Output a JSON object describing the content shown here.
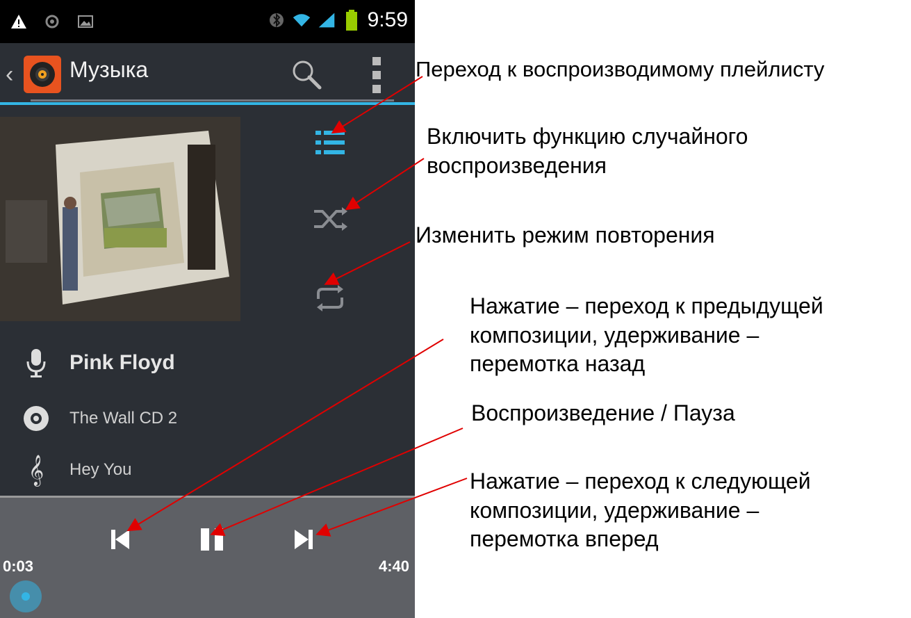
{
  "status_bar": {
    "time": "9:59",
    "left_icons": [
      "warning-icon",
      "record-icon",
      "image-icon"
    ],
    "right_icons": [
      "bluetooth-icon",
      "wifi-icon",
      "signal-icon",
      "battery-icon"
    ]
  },
  "action_bar": {
    "title": "Музыка",
    "icons": [
      "back-icon",
      "music-app-icon",
      "search-icon",
      "overflow-menu-icon"
    ],
    "accent_color": "#33b5e5"
  },
  "now_playing": {
    "artist": "Pink Floyd",
    "album": "The Wall CD 2",
    "track": "Hey You"
  },
  "side_controls": [
    "playlist-icon",
    "shuffle-icon",
    "repeat-icon"
  ],
  "playback": {
    "elapsed": "0:03",
    "duration": "4:40",
    "progress_fraction": 0.01
  },
  "annotations": {
    "playlist": "Переход к воспроизводимому плейлисту",
    "shuffle_line1": "Включить функцию случайного",
    "shuffle_line2": "воспроизведения",
    "repeat": "Изменить режим повторения",
    "prev_line1": "Нажатие – переход к предыдущей",
    "prev_line2": "композиции, удерживание –",
    "prev_line3": "перемотка назад",
    "play_pause": "Воспроизведение / Пауза",
    "next_line1": "Нажатие – переход к следующей",
    "next_line2": "композиции,  удерживание –",
    "next_line3": "перемотка вперед"
  }
}
